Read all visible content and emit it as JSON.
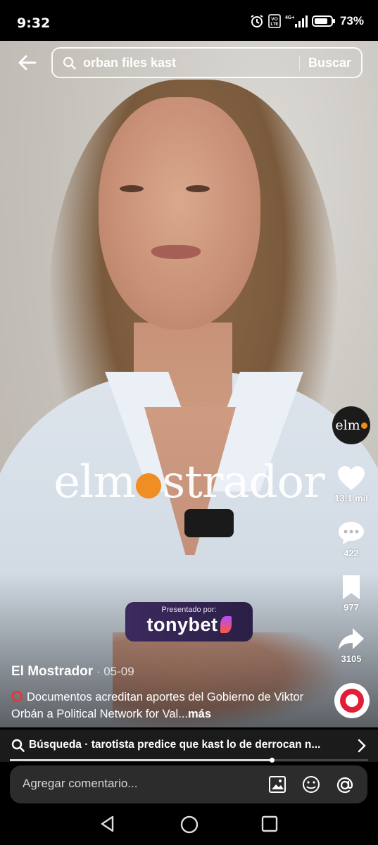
{
  "status_bar": {
    "time": "9:32",
    "net_label": "VO\nLTE",
    "signal_label": "4G+",
    "battery": "73%"
  },
  "search": {
    "query": "orban files kast",
    "action": "Buscar"
  },
  "video": {
    "watermark_left": "elm",
    "watermark_right": "strador",
    "sponsor_small": "Presentado por:",
    "sponsor_brand": "tonybet",
    "author": "El Mostrador",
    "date": " · 05-09",
    "caption": "Documentos acreditan aportes del Gobierno de Viktor Orbán a Political Network for Val...",
    "caption_more": "más",
    "progress_fraction": 0.73
  },
  "actions": {
    "avatar_text": "elm",
    "likes": "13,1 mil",
    "comments": "422",
    "saves": "977",
    "shares": "3105"
  },
  "related_search": {
    "prefix": "Búsqueda",
    "text": " · tarotista predice que kast lo de derrocan n..."
  },
  "comment_bar": {
    "placeholder": "Agregar comentario..."
  },
  "icons": [
    "back-arrow-icon",
    "search-icon",
    "heart-icon",
    "comment-icon",
    "bookmark-icon",
    "share-icon",
    "music-disc-icon",
    "image-icon",
    "emoji-icon",
    "mention-icon",
    "nav-back-icon",
    "nav-home-icon",
    "nav-recents-icon"
  ],
  "colors": {
    "accent_orange": "#f08b1c",
    "music_red": "#e21d36",
    "sponsor_purple": "#3c2a5e"
  }
}
